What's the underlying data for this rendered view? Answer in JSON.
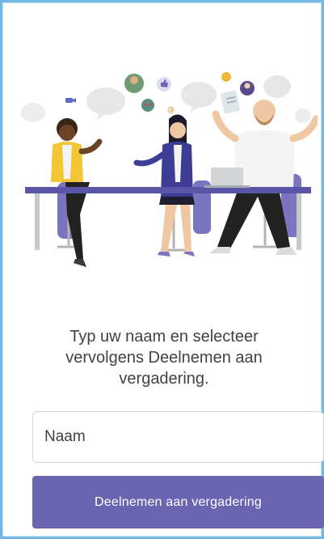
{
  "join_screen": {
    "illustration_icon": "meeting-people-illustration",
    "message_line1": "Typ uw naam en selecteer",
    "message_line2": "vervolgens Deelnemen aan",
    "message_line3": "vergadering.",
    "name_input": {
      "placeholder": "Naam",
      "value": ""
    },
    "join_button_label": "Deelnemen aan vergadering"
  },
  "colors": {
    "accent": "#6a64b1",
    "frame_border": "#74b7e3",
    "text": "#424242",
    "input_border": "#d6d6d6"
  }
}
